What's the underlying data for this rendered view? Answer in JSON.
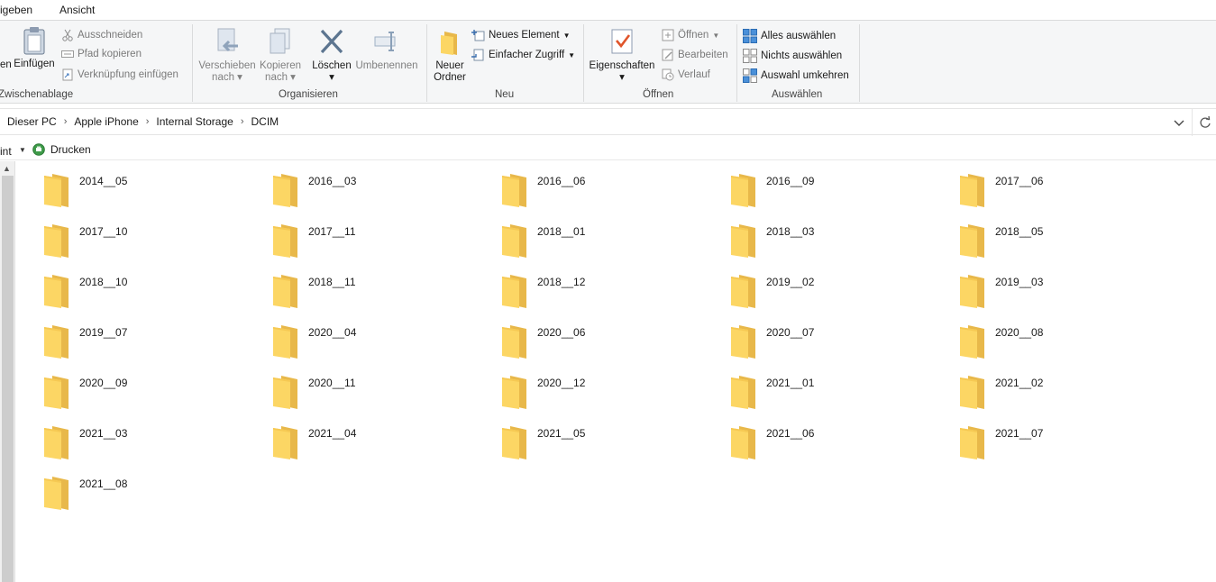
{
  "ribbon_tabs": {
    "share": "igeben",
    "view": "Ansicht"
  },
  "clipboard": {
    "copy_partial": "en",
    "paste": "Einfügen",
    "cut": "Ausschneiden",
    "copy_path": "Pfad kopieren",
    "paste_shortcut": "Verknüpfung einfügen",
    "label": "Zwischenablage"
  },
  "organize": {
    "move_l1": "Verschieben",
    "move_l2": "nach",
    "copy_l1": "Kopieren",
    "copy_l2": "nach",
    "delete": "Löschen",
    "rename": "Umbenennen",
    "label": "Organisieren"
  },
  "new": {
    "folder_l1": "Neuer",
    "folder_l2": "Ordner",
    "new_item": "Neues Element",
    "easy_access": "Einfacher Zugriff",
    "label": "Neu"
  },
  "open": {
    "properties": "Eigenschaften",
    "open": "Öffnen",
    "edit": "Bearbeiten",
    "history": "Verlauf",
    "label": "Öffnen"
  },
  "select": {
    "select_all": "Alles auswählen",
    "select_none": "Nichts auswählen",
    "invert": "Auswahl umkehren",
    "label": "Auswählen"
  },
  "breadcrumb": [
    "Dieser PC",
    "Apple iPhone",
    "Internal Storage",
    "DCIM"
  ],
  "cmdbar": {
    "print_partial": "int",
    "print": "Drucken"
  },
  "folders": [
    "2014__05",
    "2016__03",
    "2016__06",
    "2016__09",
    "2017__06",
    "2017__10",
    "2017__11",
    "2018__01",
    "2018__03",
    "2018__05",
    "2018__10",
    "2018__11",
    "2018__12",
    "2019__02",
    "2019__03",
    "2019__07",
    "2020__04",
    "2020__06",
    "2020__07",
    "2020__08",
    "2020__09",
    "2020__11",
    "2020__12",
    "2021__01",
    "2021__02",
    "2021__03",
    "2021__04",
    "2021__05",
    "2021__06",
    "2021__07",
    "2021__08"
  ],
  "colors": {
    "folder_front": "#fcd664",
    "folder_back": "#e8b84a",
    "accent": "#1e72c8"
  }
}
